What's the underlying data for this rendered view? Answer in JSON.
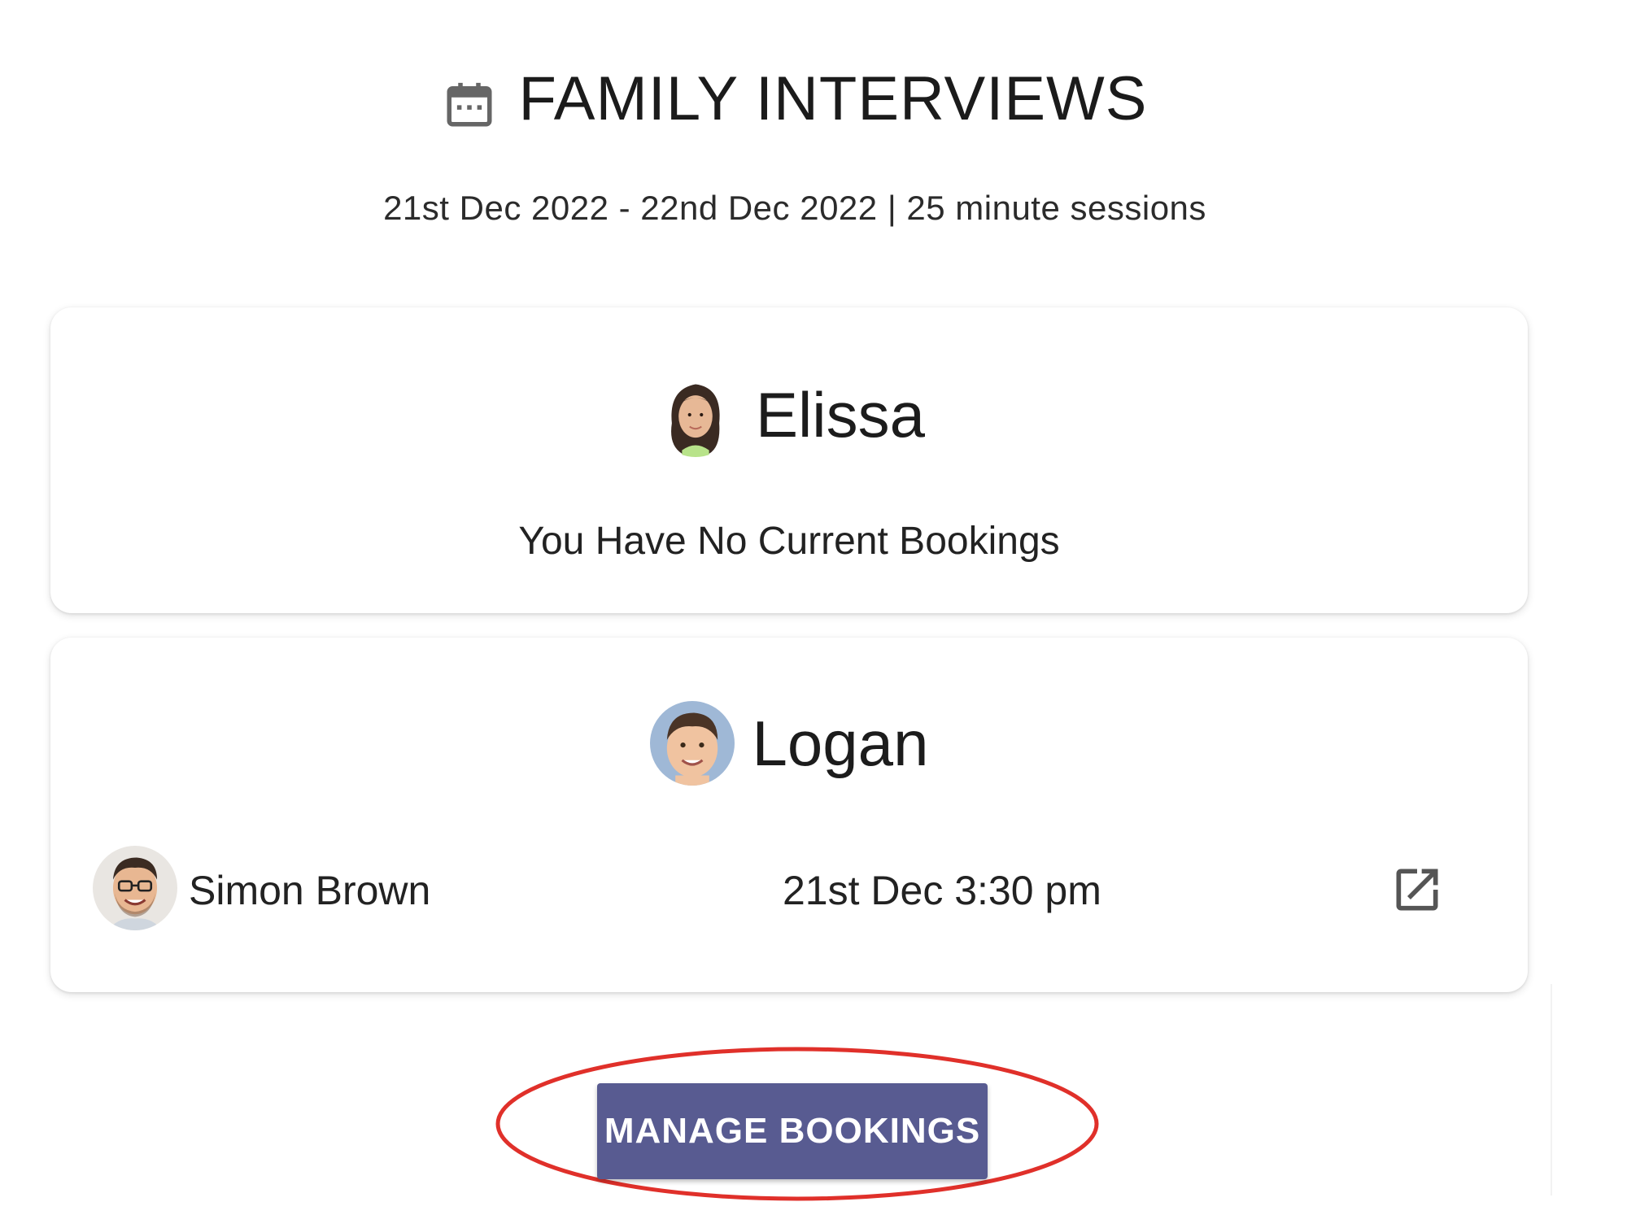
{
  "header": {
    "icon": "calendar-icon",
    "title": "FAMILY INTERVIEWS",
    "subtitle": "21st Dec 2022 - 22nd Dec 2022 | 25 minute sessions"
  },
  "students": [
    {
      "name": "Elissa",
      "avatar": "student-avatar-elissa",
      "empty_message": "You Have No Current Bookings"
    },
    {
      "name": "Logan",
      "avatar": "student-avatar-logan",
      "bookings": [
        {
          "teacher": "Simon Brown",
          "time": "21st Dec 3:30 pm",
          "action_icon": "open-in-new-icon"
        }
      ]
    }
  ],
  "actions": {
    "manage_label": "MANAGE BOOKINGS"
  },
  "colors": {
    "button": "#585b91",
    "highlight": "#e0302a"
  }
}
